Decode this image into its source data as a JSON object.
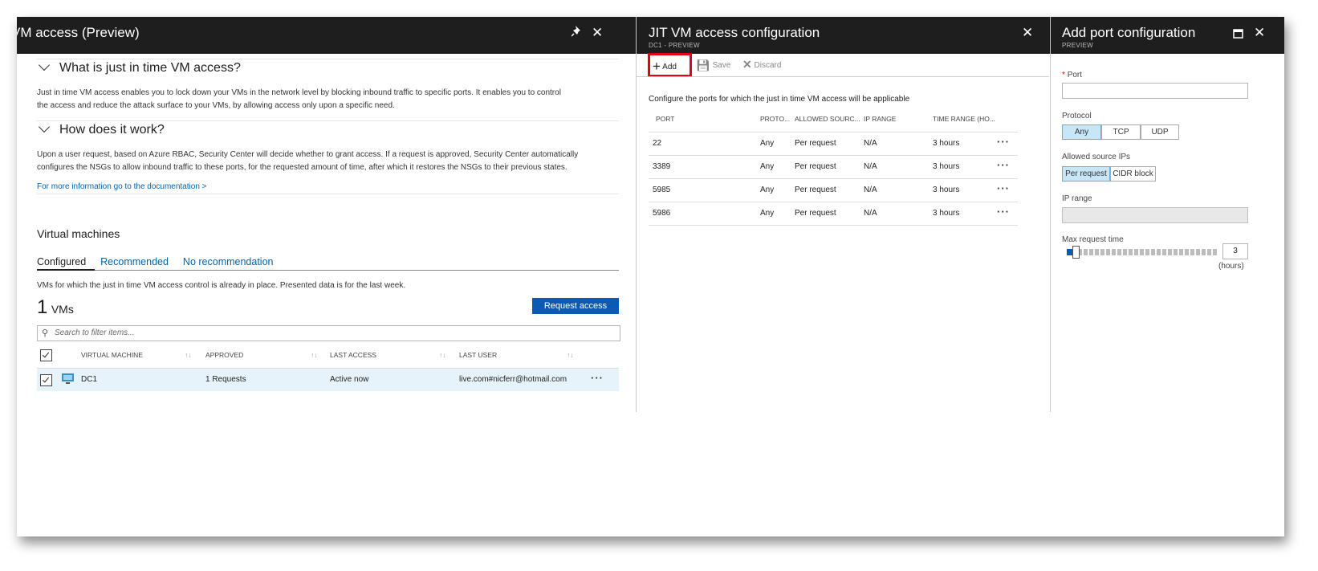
{
  "blade1": {
    "title": "VM access (Preview)",
    "pin_icon": "pin-icon",
    "close_icon": "close-icon",
    "section1_title": "What is just in time VM access?",
    "section1_text1": "Just in time VM access enables you to lock down your VMs in the network level by blocking inbound traffic to specific ports. It enables you to control",
    "section1_text2": "the access and reduce the attack surface to your VMs, by allowing access only upon a specific need.",
    "section2_title": "How does it work?",
    "section2_text1": "Upon a user request, based on Azure RBAC, Security Center will decide whether to grant access. If a request is approved, Security Center automatically",
    "section2_text2": "configures the NSGs to allow inbound traffic to these ports, for the requested amount of time, after which it restores the NSGs to their previous states.",
    "doc_link": "For more information go to the documentation >",
    "vm_heading": "Virtual machines",
    "tabs": [
      "Configured",
      "Recommended",
      "No recommendation"
    ],
    "tab_desc": "VMs for which the just in time VM access control is already in place. Presented data is for the last week.",
    "vm_count": "1",
    "vm_count_label": "VMs",
    "request_button": "Request access",
    "search_placeholder": "Search to filter items...",
    "columns": [
      "VIRTUAL MACHINE",
      "APPROVED",
      "LAST ACCESS",
      "LAST USER"
    ],
    "rows": [
      {
        "name": "DC1",
        "approved": "1 Requests",
        "last_access": "Active now",
        "last_user": "live.com#nicferr@hotmail.com"
      }
    ]
  },
  "blade2": {
    "title": "JIT VM access configuration",
    "subtitle": "DC1 - PREVIEW",
    "toolbar": {
      "add": "Add",
      "save": "Save",
      "discard": "Discard"
    },
    "description": "Configure the ports for which the just in time VM access will be applicable",
    "columns": [
      "PORT",
      "PROTO...",
      "ALLOWED SOURC...",
      "IP RANGE",
      "TIME RANGE (HO..."
    ],
    "rows": [
      {
        "port": "22",
        "proto": "Any",
        "source": "Per request",
        "ip": "N/A",
        "time": "3 hours"
      },
      {
        "port": "3389",
        "proto": "Any",
        "source": "Per request",
        "ip": "N/A",
        "time": "3 hours"
      },
      {
        "port": "5985",
        "proto": "Any",
        "source": "Per request",
        "ip": "N/A",
        "time": "3 hours"
      },
      {
        "port": "5986",
        "proto": "Any",
        "source": "Per request",
        "ip": "N/A",
        "time": "3 hours"
      }
    ]
  },
  "blade3": {
    "title": "Add port configuration",
    "subtitle": "PREVIEW",
    "port_label": "Port",
    "required_mark": "*",
    "protocol_label": "Protocol",
    "protocol_options": [
      "Any",
      "TCP",
      "UDP"
    ],
    "protocol_selected": "Any",
    "source_label": "Allowed source IPs",
    "source_options": [
      "Per request",
      "CIDR block"
    ],
    "source_selected": "Per request",
    "ip_label": "IP range",
    "max_time_label": "Max request time",
    "max_time_value": "3",
    "max_time_unit": "(hours)",
    "slider_value_hours": 3
  },
  "colors": {
    "accent": "#0b5ab3",
    "highlight": "#e0001b",
    "header": "#1e1e1e",
    "selected": "#c7e6f7"
  }
}
